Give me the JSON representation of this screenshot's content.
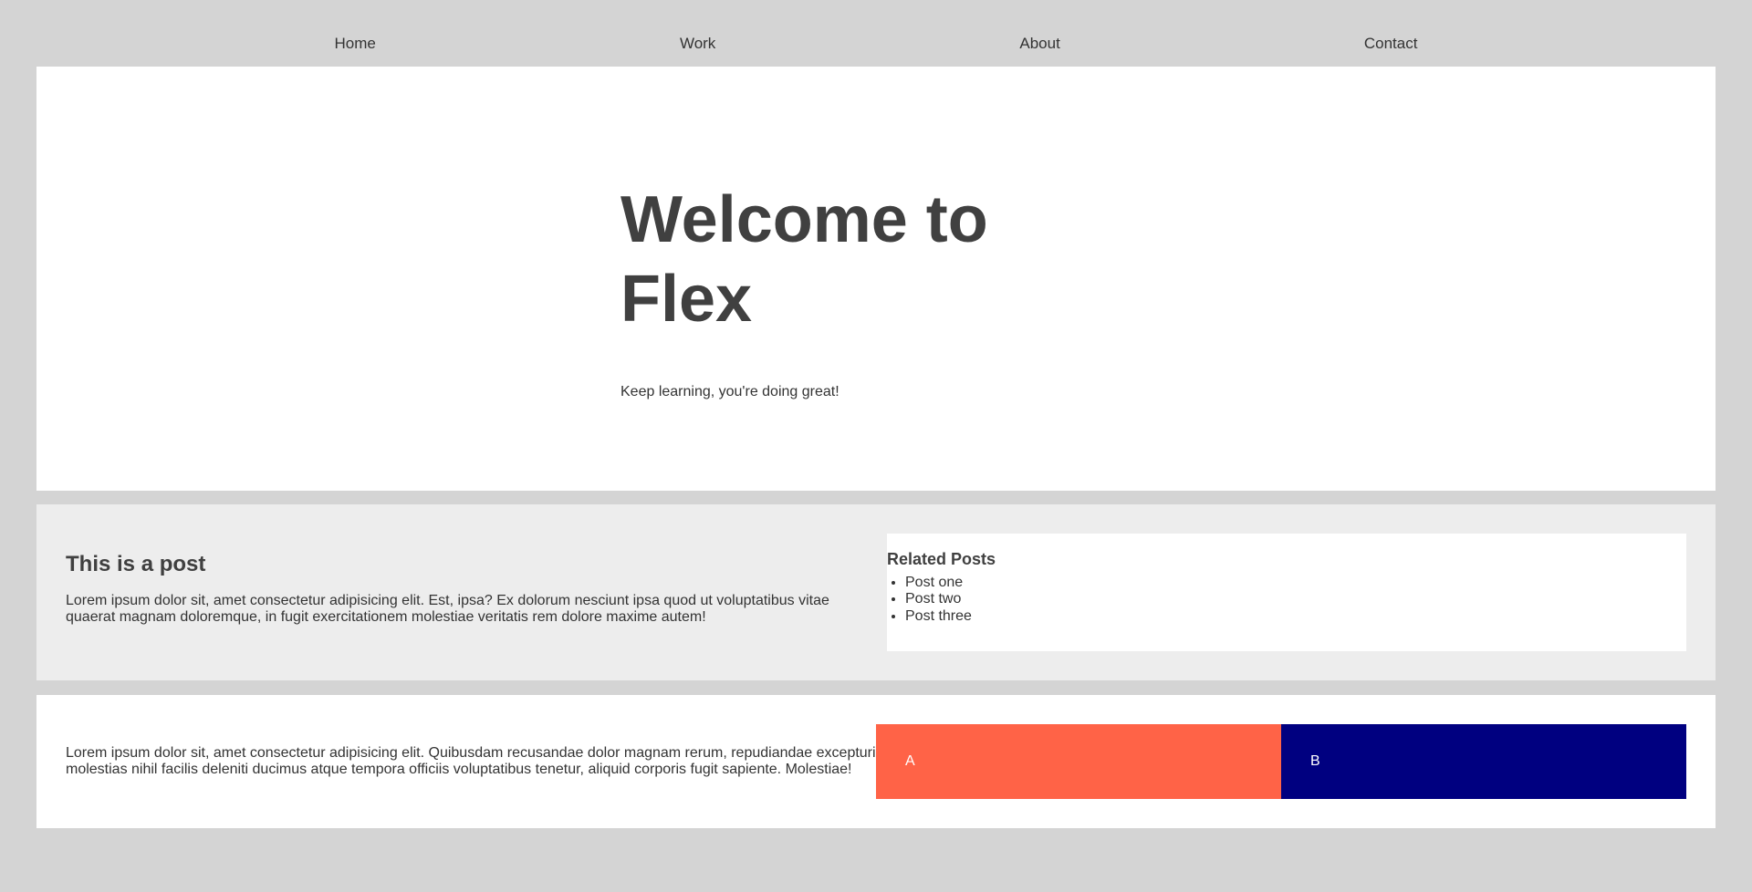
{
  "nav": {
    "items": [
      "Home",
      "Work",
      "About",
      "Contact"
    ]
  },
  "hero": {
    "title": "Welcome to Flex",
    "subtitle": "Keep learning, you're doing great!"
  },
  "post": {
    "title": "This is a post",
    "text": "Lorem ipsum dolor sit, amet consectetur adipisicing elit. Est, ipsa? Ex dolorum nesciunt ipsa quod ut voluptatibus vitae quaerat magnam doloremque, in fugit exercitationem molestiae veritatis rem dolore maxime autem!"
  },
  "related": {
    "title": "Related Posts",
    "items": [
      "Post one",
      "Post two",
      "Post three"
    ]
  },
  "bottom": {
    "text": "Lorem ipsum dolor sit, amet consectetur adipisicing elit. Quibusdam recusandae dolor magnam rerum, repudiandae excepturi molestias nihil facilis deleniti ducimus atque tempora officiis voluptatibus tenetur, aliquid corporis fugit sapiente. Molestiae!",
    "box_a": "A",
    "box_b": "B"
  },
  "colors": {
    "page_bg": "#d4d4d4",
    "box_a": "#ff6347",
    "box_b": "#000080"
  }
}
